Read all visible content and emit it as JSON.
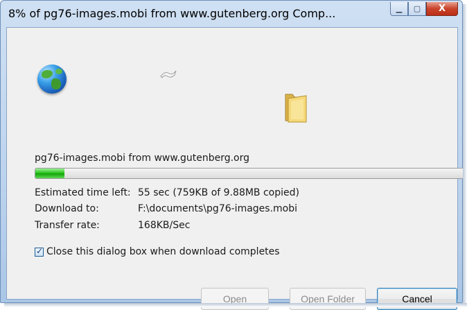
{
  "window": {
    "title": "8% of pg76-images.mobi from www.gutenberg.org Comp...",
    "minimize_glyph": "▁",
    "maximize_glyph": "▢",
    "close_glyph": "X"
  },
  "download": {
    "filename_line": "pg76-images.mobi from www.gutenberg.org",
    "progress_fraction": 0.068,
    "rows": [
      {
        "label": "Estimated time left:",
        "value": "55 sec (759KB of 9.88MB copied)"
      },
      {
        "label": "Download to:",
        "value": "F:\\documents\\pg76-images.mobi"
      },
      {
        "label": "Transfer rate:",
        "value": "168KB/Sec"
      }
    ],
    "close_checkbox_label": "Close this dialog box when download completes",
    "close_checkbox_checked": true
  },
  "icons": {
    "source": "globe-icon",
    "transfer": "flying-paper-icon",
    "destination": "folder-icon"
  },
  "buttons": {
    "open": "Open",
    "open_folder": "Open Folder",
    "cancel": "Cancel"
  },
  "colors": {
    "progress": "#14a50c",
    "frame": "#bcd3ee",
    "close": "#c9432a"
  }
}
